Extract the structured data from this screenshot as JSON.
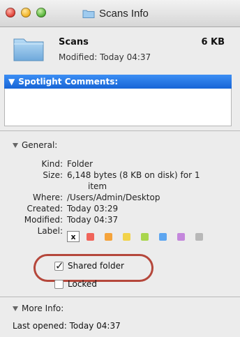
{
  "window": {
    "title": "Scans Info"
  },
  "header": {
    "name": "Scans",
    "size": "6 KB",
    "modified": "Modified: Today 04:37"
  },
  "spotlight": {
    "label": "Spotlight Comments:",
    "value": ""
  },
  "general": {
    "title": "General:",
    "rows": [
      {
        "key": "Kind:",
        "value": "Folder"
      },
      {
        "key": "Size:",
        "value_line1": "6,148 bytes (8 KB on disk) for 1",
        "value_line2": "item"
      },
      {
        "key": "Where:",
        "value": "/Users/Admin/Desktop"
      },
      {
        "key": "Created:",
        "value": "Today 03:29"
      },
      {
        "key": "Modified:",
        "value": "Today 04:37"
      },
      {
        "key": "Label:",
        "value": "x"
      }
    ],
    "label_colors": [
      "#f0645a",
      "#f5a33b",
      "#f2d34a",
      "#a9d64d",
      "#5ea6f0",
      "#c487dc",
      "#b8b8b8"
    ],
    "shared_folder": {
      "label": "Shared folder",
      "checked": true
    },
    "locked": {
      "label": "Locked",
      "checked": false
    },
    "highlight_color": "#b5473b"
  },
  "more_info": {
    "title": "More Info:",
    "last_opened": "Last opened: Today 04:37"
  }
}
